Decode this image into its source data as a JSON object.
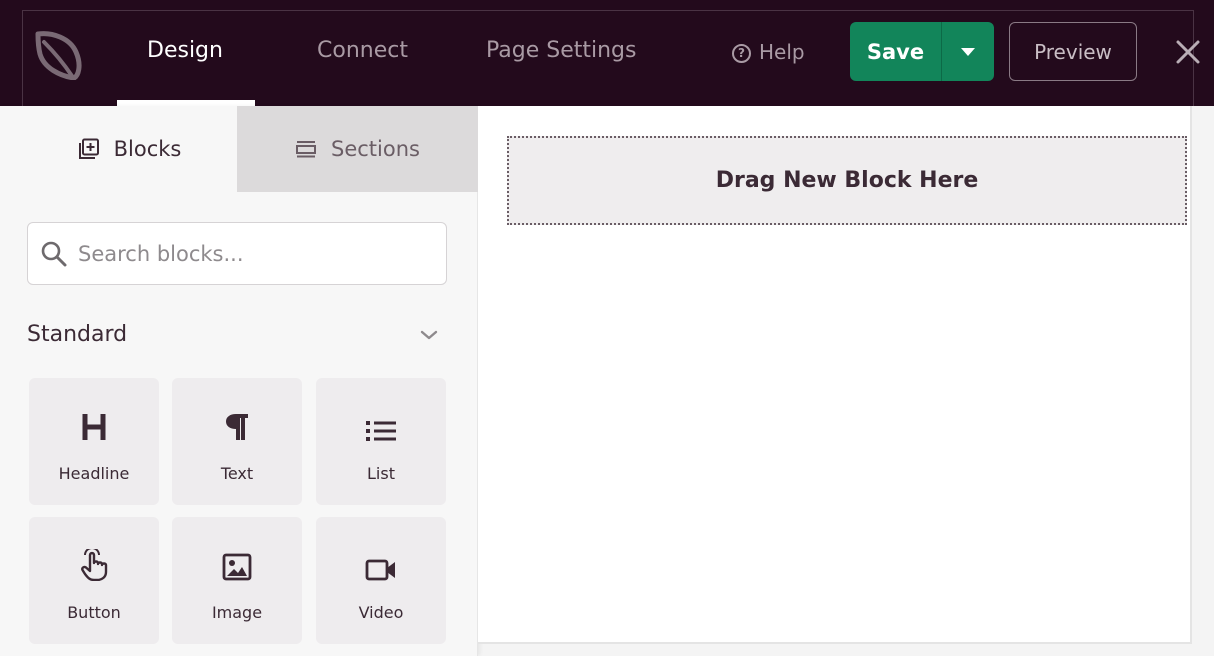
{
  "header": {
    "nav": [
      {
        "label": "Design",
        "active": true
      },
      {
        "label": "Connect",
        "active": false
      },
      {
        "label": "Page Settings",
        "active": false
      }
    ],
    "help_label": "Help",
    "save_label": "Save",
    "preview_label": "Preview",
    "colors": {
      "background": "#230a1c",
      "save": "#12855a"
    }
  },
  "sidebar": {
    "tabs": [
      {
        "label": "Blocks",
        "active": true,
        "icon": "plus-square-icon"
      },
      {
        "label": "Sections",
        "active": false,
        "icon": "sections-icon"
      }
    ],
    "search": {
      "placeholder": "Search blocks...",
      "value": ""
    },
    "section_title": "Standard",
    "blocks": [
      {
        "label": "Headline",
        "icon": "headline-icon"
      },
      {
        "label": "Text",
        "icon": "paragraph-icon"
      },
      {
        "label": "List",
        "icon": "list-icon"
      },
      {
        "label": "Button",
        "icon": "pointer-hand-icon"
      },
      {
        "label": "Image",
        "icon": "image-icon"
      },
      {
        "label": "Video",
        "icon": "video-camera-icon"
      }
    ]
  },
  "canvas": {
    "drop_label": "Drag New Block Here"
  }
}
